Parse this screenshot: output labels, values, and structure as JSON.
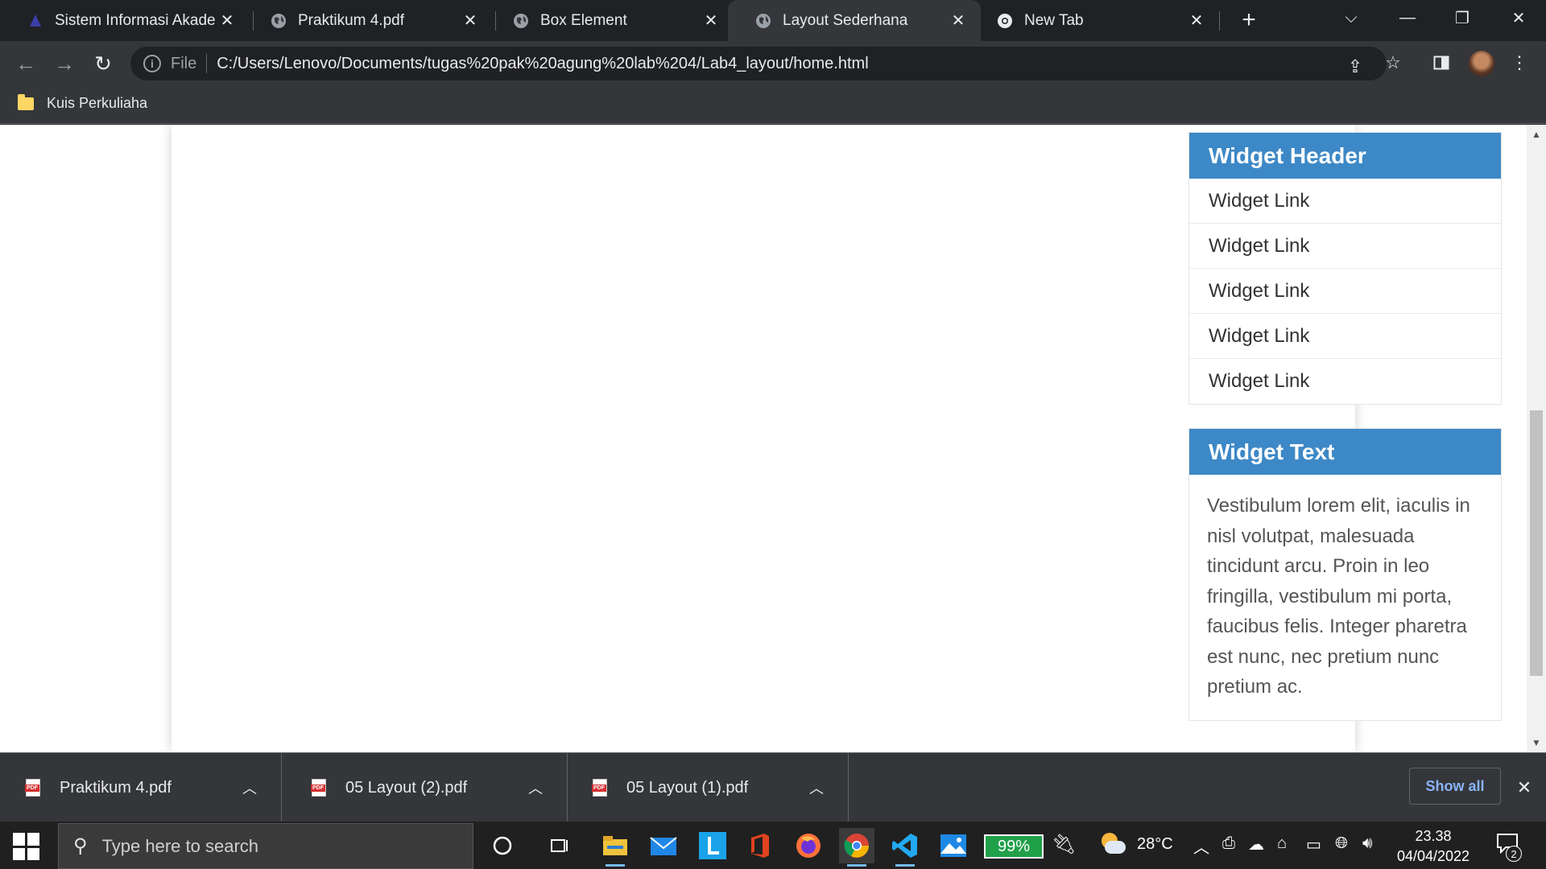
{
  "browser": {
    "tabs": [
      {
        "title": "Sistem Informasi Akademik",
        "active": false
      },
      {
        "title": "Praktikum 4.pdf",
        "active": false
      },
      {
        "title": "Box Element",
        "active": false
      },
      {
        "title": "Layout Sederhana",
        "active": true
      },
      {
        "title": "New Tab",
        "active": false
      }
    ],
    "omnibox": {
      "scheme_label": "File",
      "url": "C:/Users/Lenovo/Documents/tugas%20pak%20agung%20lab%204/Lab4_layout/home.html"
    },
    "bookmarks": [
      {
        "label": "Kuis Perkuliaha"
      }
    ]
  },
  "page": {
    "widgets": [
      {
        "header": "Widget Header",
        "links": [
          "Widget Link",
          "Widget Link",
          "Widget Link",
          "Widget Link",
          "Widget Link"
        ]
      },
      {
        "header": "Widget Text",
        "text": "Vestibulum lorem elit, iaculis in nisl volutpat, malesuada tincidunt arcu. Proin in leo fringilla, vestibulum mi porta, faucibus felis. Integer pharetra est nunc, nec pretium nunc pretium ac."
      }
    ]
  },
  "downloads": {
    "items": [
      {
        "name": "Praktikum 4.pdf"
      },
      {
        "name": "05 Layout (2).pdf"
      },
      {
        "name": "05 Layout (1).pdf"
      }
    ],
    "show_all": "Show all",
    "pdf_badge": "PDF"
  },
  "taskbar": {
    "search_placeholder": "Type here to search",
    "battery": "99%",
    "temperature": "28°C",
    "time": "23.38",
    "date": "04/04/2022",
    "notification_count": "2",
    "pinned_icons": [
      "cortana-icon",
      "task-view-icon",
      "file-explorer-icon",
      "mail-icon",
      "l-app-icon",
      "office-icon",
      "firefox-icon",
      "chrome-icon",
      "vscode-icon",
      "photos-icon"
    ]
  },
  "colors": {
    "widget_header_bg": "#3d88c6",
    "battery_green": "#21a04a",
    "link_blue": "#8ab4f8"
  }
}
